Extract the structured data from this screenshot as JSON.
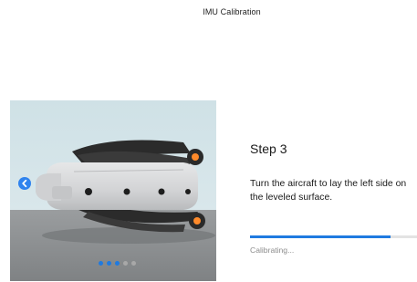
{
  "header": {
    "title": "IMU Calibration"
  },
  "illustration": {
    "subject": "aircraft-on-left-side",
    "colors": {
      "background_top": "#cfe1e6",
      "floor": "#8c8f91",
      "body": "#d7d8da",
      "arms": "#2b2b2b",
      "motor_accent": "#ff8a2a"
    }
  },
  "carousel": {
    "prev_icon": "chevron-left-icon",
    "page_count": 5,
    "active_pages": 3,
    "active_color": "#1f7ae0",
    "inactive_color": "#a8a8a8"
  },
  "step": {
    "title": "Step 3",
    "instruction": "Turn the aircraft to lay the left side on the leveled surface."
  },
  "progress": {
    "value": 0.84,
    "status": "Calibrating..."
  }
}
